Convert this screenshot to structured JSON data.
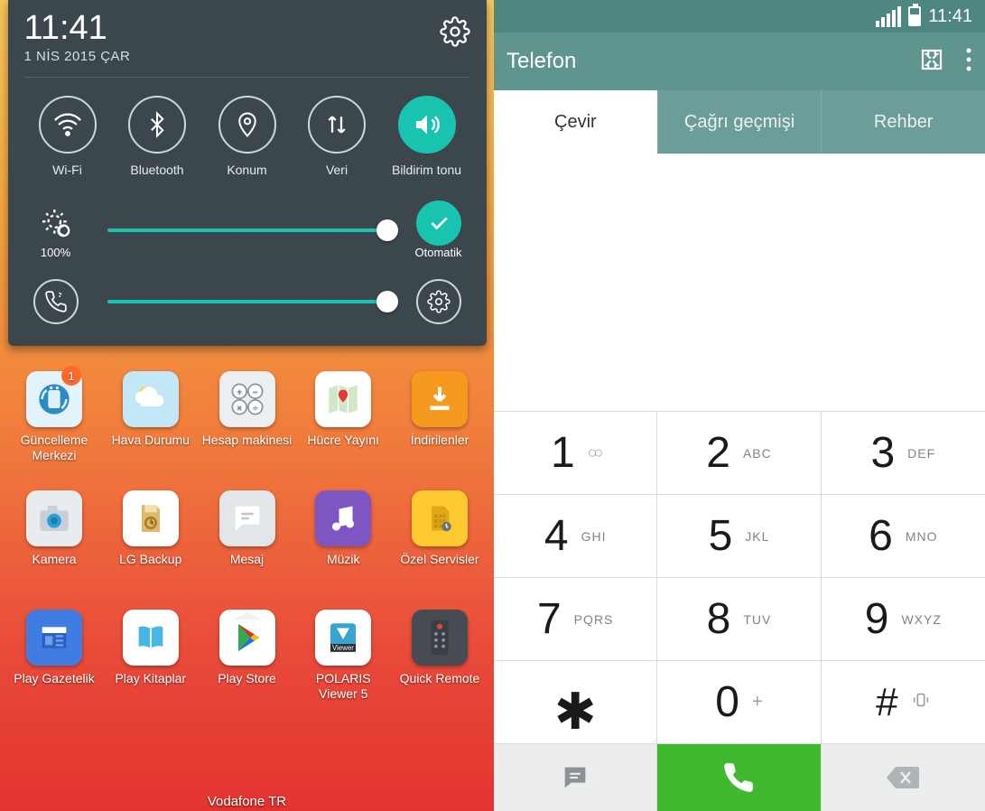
{
  "left": {
    "time": "11:41",
    "date": "1 NİS 2015 ÇAR",
    "quick_settings": [
      {
        "name": "wifi",
        "label": "Wi-Fi",
        "active": false
      },
      {
        "name": "bt",
        "label": "Bluetooth",
        "active": false
      },
      {
        "name": "loc",
        "label": "Konum",
        "active": false
      },
      {
        "name": "data",
        "label": "Veri",
        "active": false
      },
      {
        "name": "sound",
        "label": "Bildirim tonu",
        "active": true
      }
    ],
    "brightness": {
      "label": "100%",
      "percent": 100,
      "auto_label": "Otomatik"
    },
    "apps": [
      [
        {
          "name": "update",
          "label": "Güncelleme Merkezi",
          "badge": "1"
        },
        {
          "name": "weather",
          "label": "Hava Durumu"
        },
        {
          "name": "calc",
          "label": "Hesap makinesi"
        },
        {
          "name": "maps",
          "label": "Hücre Yayını"
        },
        {
          "name": "dl",
          "label": "İndirilenler"
        }
      ],
      [
        {
          "name": "camera",
          "label": "Kamera"
        },
        {
          "name": "backup",
          "label": "LG Backup"
        },
        {
          "name": "msg",
          "label": "Mesaj"
        },
        {
          "name": "music",
          "label": "Müzik"
        },
        {
          "name": "serv",
          "label": "Özel Servisler"
        }
      ],
      [
        {
          "name": "news",
          "label": "Play Gazetelik"
        },
        {
          "name": "books",
          "label": "Play Kitaplar"
        },
        {
          "name": "play",
          "label": "Play Store"
        },
        {
          "name": "polaris",
          "label": "POLARIS Viewer 5"
        },
        {
          "name": "remote",
          "label": "Quick Remote"
        }
      ]
    ],
    "carrier": "Vodafone TR"
  },
  "right": {
    "status_time": "11:41",
    "title": "Telefon",
    "tabs": [
      {
        "name": "dial",
        "label": "Çevir",
        "active": true
      },
      {
        "name": "history",
        "label": "Çağrı geçmişi",
        "active": false
      },
      {
        "name": "contacts",
        "label": "Rehber",
        "active": false
      }
    ],
    "keys": [
      {
        "d": "1",
        "sub": "voicemail"
      },
      {
        "d": "2",
        "sub": "ABC"
      },
      {
        "d": "3",
        "sub": "DEF"
      },
      {
        "d": "4",
        "sub": "GHI"
      },
      {
        "d": "5",
        "sub": "JKL"
      },
      {
        "d": "6",
        "sub": "MNO"
      },
      {
        "d": "7",
        "sub": "PQRS"
      },
      {
        "d": "8",
        "sub": "TUV"
      },
      {
        "d": "9",
        "sub": "WXYZ"
      },
      {
        "d": "*",
        "sub": ""
      },
      {
        "d": "0",
        "sub": "+"
      },
      {
        "d": "#",
        "sub": "vibrate"
      }
    ]
  }
}
